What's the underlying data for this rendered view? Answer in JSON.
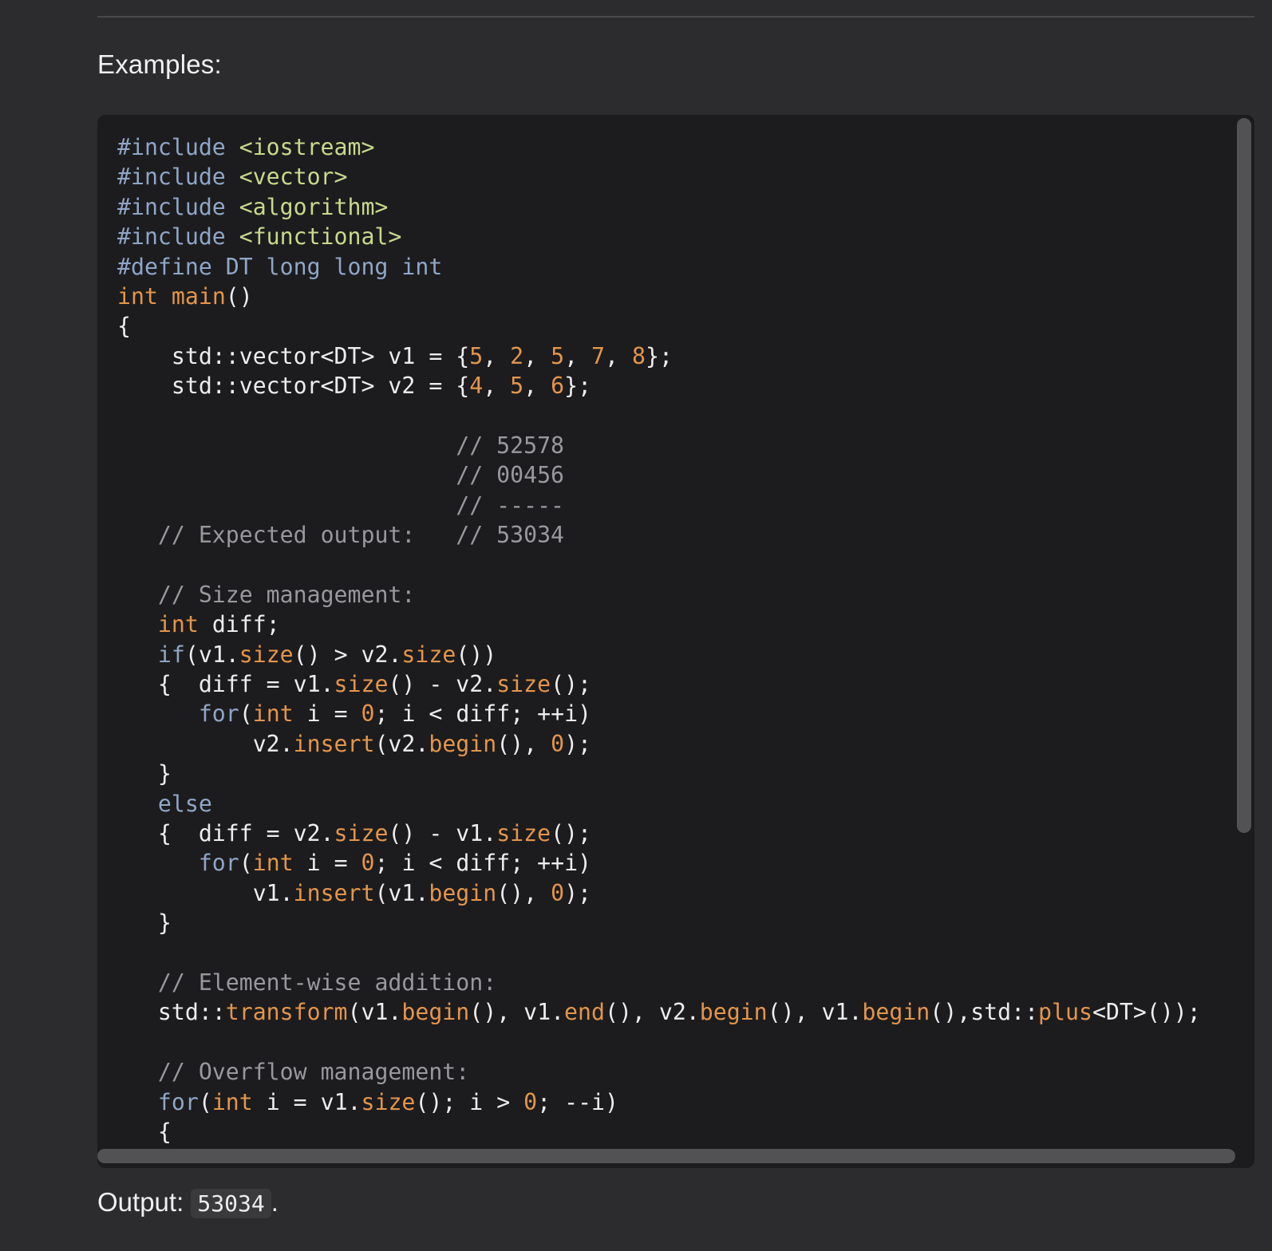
{
  "section": {
    "heading": "Examples:"
  },
  "code_block": {
    "language": "cpp",
    "lines": [
      [
        [
          "pre",
          "#include "
        ],
        [
          "hdr",
          "<iostream>"
        ]
      ],
      [
        [
          "pre",
          "#include "
        ],
        [
          "hdr",
          "<vector>"
        ]
      ],
      [
        [
          "pre",
          "#include "
        ],
        [
          "hdr",
          "<algorithm>"
        ]
      ],
      [
        [
          "pre",
          "#include "
        ],
        [
          "hdr",
          "<functional>"
        ]
      ],
      [
        [
          "pre",
          "#define DT long long int"
        ]
      ],
      [
        [
          "type",
          "int"
        ],
        [
          "plain",
          " "
        ],
        [
          "func",
          "main"
        ],
        [
          "plain",
          "()"
        ]
      ],
      [
        [
          "plain",
          "{"
        ]
      ],
      [
        [
          "plain",
          "    std::vector<DT> v1 = {"
        ],
        [
          "num",
          "5"
        ],
        [
          "plain",
          ", "
        ],
        [
          "num",
          "2"
        ],
        [
          "plain",
          ", "
        ],
        [
          "num",
          "5"
        ],
        [
          "plain",
          ", "
        ],
        [
          "num",
          "7"
        ],
        [
          "plain",
          ", "
        ],
        [
          "num",
          "8"
        ],
        [
          "plain",
          "};"
        ]
      ],
      [
        [
          "plain",
          "    std::vector<DT> v2 = {"
        ],
        [
          "num",
          "4"
        ],
        [
          "plain",
          ", "
        ],
        [
          "num",
          "5"
        ],
        [
          "plain",
          ", "
        ],
        [
          "num",
          "6"
        ],
        [
          "plain",
          "};"
        ]
      ],
      [],
      [
        [
          "plain",
          "                         "
        ],
        [
          "cm",
          "// 52578"
        ]
      ],
      [
        [
          "plain",
          "                         "
        ],
        [
          "cm",
          "// 00456"
        ]
      ],
      [
        [
          "plain",
          "                         "
        ],
        [
          "cm",
          "// -----"
        ]
      ],
      [
        [
          "plain",
          "   "
        ],
        [
          "cm",
          "// Expected output:   // 53034"
        ]
      ],
      [],
      [
        [
          "plain",
          "   "
        ],
        [
          "cm",
          "// Size management:"
        ]
      ],
      [
        [
          "plain",
          "   "
        ],
        [
          "type",
          "int"
        ],
        [
          "plain",
          " diff;"
        ]
      ],
      [
        [
          "plain",
          "   "
        ],
        [
          "kw",
          "if"
        ],
        [
          "plain",
          "(v1."
        ],
        [
          "func",
          "size"
        ],
        [
          "plain",
          "() > v2."
        ],
        [
          "func",
          "size"
        ],
        [
          "plain",
          "())"
        ]
      ],
      [
        [
          "plain",
          "   {  diff = v1."
        ],
        [
          "func",
          "size"
        ],
        [
          "plain",
          "() - v2."
        ],
        [
          "func",
          "size"
        ],
        [
          "plain",
          "();"
        ]
      ],
      [
        [
          "plain",
          "      "
        ],
        [
          "kw",
          "for"
        ],
        [
          "plain",
          "("
        ],
        [
          "type",
          "int"
        ],
        [
          "plain",
          " i = "
        ],
        [
          "num",
          "0"
        ],
        [
          "plain",
          "; i < diff; ++i)"
        ]
      ],
      [
        [
          "plain",
          "          v2."
        ],
        [
          "func",
          "insert"
        ],
        [
          "plain",
          "(v2."
        ],
        [
          "func",
          "begin"
        ],
        [
          "plain",
          "(), "
        ],
        [
          "num",
          "0"
        ],
        [
          "plain",
          ");"
        ]
      ],
      [
        [
          "plain",
          "   }"
        ]
      ],
      [
        [
          "plain",
          "   "
        ],
        [
          "kw",
          "else"
        ]
      ],
      [
        [
          "plain",
          "   {  diff = v2."
        ],
        [
          "func",
          "size"
        ],
        [
          "plain",
          "() - v1."
        ],
        [
          "func",
          "size"
        ],
        [
          "plain",
          "();"
        ]
      ],
      [
        [
          "plain",
          "      "
        ],
        [
          "kw",
          "for"
        ],
        [
          "plain",
          "("
        ],
        [
          "type",
          "int"
        ],
        [
          "plain",
          " i = "
        ],
        [
          "num",
          "0"
        ],
        [
          "plain",
          "; i < diff; ++i)"
        ]
      ],
      [
        [
          "plain",
          "          v1."
        ],
        [
          "func",
          "insert"
        ],
        [
          "plain",
          "(v1."
        ],
        [
          "func",
          "begin"
        ],
        [
          "plain",
          "(), "
        ],
        [
          "num",
          "0"
        ],
        [
          "plain",
          ");"
        ]
      ],
      [
        [
          "plain",
          "   }"
        ]
      ],
      [],
      [
        [
          "plain",
          "   "
        ],
        [
          "cm",
          "// Element-wise addition:"
        ]
      ],
      [
        [
          "plain",
          "   std::"
        ],
        [
          "func",
          "transform"
        ],
        [
          "plain",
          "(v1."
        ],
        [
          "func",
          "begin"
        ],
        [
          "plain",
          "(), v1."
        ],
        [
          "func",
          "end"
        ],
        [
          "plain",
          "(), v2."
        ],
        [
          "func",
          "begin"
        ],
        [
          "plain",
          "(), v1."
        ],
        [
          "func",
          "begin"
        ],
        [
          "plain",
          "(),std::"
        ],
        [
          "func",
          "plus"
        ],
        [
          "plain",
          "<DT>());"
        ]
      ],
      [],
      [
        [
          "plain",
          "   "
        ],
        [
          "cm",
          "// Overflow management:"
        ]
      ],
      [
        [
          "plain",
          "   "
        ],
        [
          "kw",
          "for"
        ],
        [
          "plain",
          "("
        ],
        [
          "type",
          "int"
        ],
        [
          "plain",
          " i = v1."
        ],
        [
          "func",
          "size"
        ],
        [
          "plain",
          "(); i > "
        ],
        [
          "num",
          "0"
        ],
        [
          "plain",
          "; --i)"
        ]
      ],
      [
        [
          "plain",
          "   {"
        ]
      ]
    ]
  },
  "output": {
    "label": "Output: ",
    "value": "53034",
    "suffix": "."
  },
  "colors": {
    "background": "#2c2c2e",
    "code_background": "#1c1c1e",
    "preprocessor": "#8fa6c7",
    "header": "#c8d98c",
    "type_func_number": "#e4954b",
    "comment": "#98989d"
  }
}
